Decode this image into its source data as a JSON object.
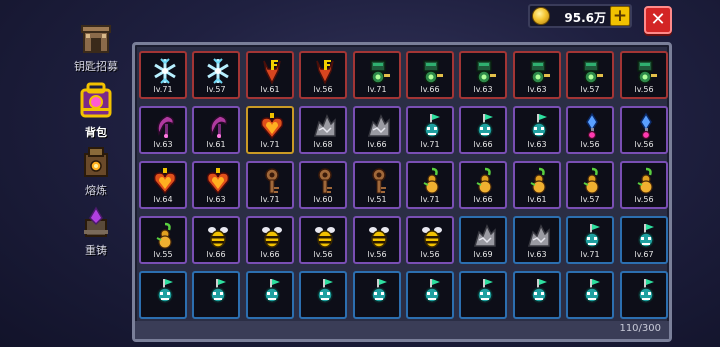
{
  "nav": [
    {
      "label": "钥匙招募",
      "icon": "gate-icon",
      "active": false
    },
    {
      "label": "背包",
      "icon": "backpack-icon",
      "active": true
    },
    {
      "label": "熔炼",
      "icon": "furnace-icon",
      "active": false
    },
    {
      "label": "重铸",
      "icon": "recast-icon",
      "active": false
    }
  ],
  "currency": {
    "value": "95.6万",
    "icon": "coin-icon"
  },
  "capacity": "110/300",
  "rarity_colors": {
    "red": "#a33535",
    "gold": "#c99a25",
    "purple": "#7a4fb4",
    "blue": "#2c6fb0"
  },
  "inventory": [
    [
      {
        "icon": "ice-key-icon",
        "level": "lv.71",
        "rarity": "red"
      },
      {
        "icon": "ice-key-icon",
        "level": "lv.57",
        "rarity": "red"
      },
      {
        "icon": "demon-key-icon",
        "level": "lv.61",
        "rarity": "red"
      },
      {
        "icon": "demon-key-icon",
        "level": "lv.56",
        "rarity": "red"
      },
      {
        "icon": "green-helmet-key-icon",
        "level": "lv.71",
        "rarity": "red"
      },
      {
        "icon": "green-helmet-key-icon",
        "level": "lv.66",
        "rarity": "red"
      },
      {
        "icon": "green-helmet-key-icon",
        "level": "lv.63",
        "rarity": "red"
      },
      {
        "icon": "green-helmet-key-icon",
        "level": "lv.63",
        "rarity": "red"
      },
      {
        "icon": "green-helmet-key-icon",
        "level": "lv.57",
        "rarity": "red"
      },
      {
        "icon": "green-helmet-key-icon",
        "level": "lv.56",
        "rarity": "red"
      }
    ],
    [
      {
        "icon": "scythe-key-icon",
        "level": "lv.63",
        "rarity": "purple"
      },
      {
        "icon": "scythe-key-icon",
        "level": "lv.61",
        "rarity": "purple"
      },
      {
        "icon": "fire-heart-key-icon",
        "level": "lv.71",
        "rarity": "gold"
      },
      {
        "icon": "stone-key-icon",
        "level": "lv.68",
        "rarity": "purple"
      },
      {
        "icon": "stone-key-icon",
        "level": "lv.66",
        "rarity": "purple"
      },
      {
        "icon": "flag-skull-key-icon",
        "level": "lv.71",
        "rarity": "purple"
      },
      {
        "icon": "flag-skull-key-icon",
        "level": "lv.66",
        "rarity": "purple"
      },
      {
        "icon": "flag-skull-key-icon",
        "level": "lv.63",
        "rarity": "purple"
      },
      {
        "icon": "crystal-key-icon",
        "level": "lv.56",
        "rarity": "purple"
      },
      {
        "icon": "crystal-key-icon",
        "level": "lv.56",
        "rarity": "purple"
      }
    ],
    [
      {
        "icon": "fire-heart-key-icon",
        "level": "lv.64",
        "rarity": "purple"
      },
      {
        "icon": "fire-heart-key-icon",
        "level": "lv.63",
        "rarity": "purple"
      },
      {
        "icon": "bronze-key-icon",
        "level": "lv.71",
        "rarity": "purple"
      },
      {
        "icon": "bronze-key-icon",
        "level": "lv.60",
        "rarity": "purple"
      },
      {
        "icon": "bronze-key-icon",
        "level": "lv.51",
        "rarity": "purple"
      },
      {
        "icon": "gourd-key-icon",
        "level": "lv.71",
        "rarity": "purple"
      },
      {
        "icon": "gourd-key-icon",
        "level": "lv.66",
        "rarity": "purple"
      },
      {
        "icon": "gourd-key-icon",
        "level": "lv.61",
        "rarity": "purple"
      },
      {
        "icon": "gourd-key-icon",
        "level": "lv.57",
        "rarity": "purple"
      },
      {
        "icon": "gourd-key-icon",
        "level": "lv.56",
        "rarity": "purple"
      }
    ],
    [
      {
        "icon": "gourd-key-icon",
        "level": "lv.55",
        "rarity": "purple"
      },
      {
        "icon": "bee-key-icon",
        "level": "lv.66",
        "rarity": "purple"
      },
      {
        "icon": "bee-key-icon",
        "level": "lv.66",
        "rarity": "purple"
      },
      {
        "icon": "bee-key-icon",
        "level": "lv.56",
        "rarity": "purple"
      },
      {
        "icon": "bee-key-icon",
        "level": "lv.56",
        "rarity": "purple"
      },
      {
        "icon": "bee-key-icon",
        "level": "lv.56",
        "rarity": "purple"
      },
      {
        "icon": "stone-key-icon",
        "level": "lv.69",
        "rarity": "blue"
      },
      {
        "icon": "stone-key-icon",
        "level": "lv.63",
        "rarity": "blue"
      },
      {
        "icon": "flag-skull-key-icon",
        "level": "lv.71",
        "rarity": "blue"
      },
      {
        "icon": "flag-skull-key-icon",
        "level": "lv.67",
        "rarity": "blue"
      }
    ],
    [
      {
        "icon": "flag-skull-key-icon",
        "level": "",
        "rarity": "blue"
      },
      {
        "icon": "flag-skull-key-icon",
        "level": "",
        "rarity": "blue"
      },
      {
        "icon": "flag-skull-key-icon",
        "level": "",
        "rarity": "blue"
      },
      {
        "icon": "flag-skull-key-icon",
        "level": "",
        "rarity": "blue"
      },
      {
        "icon": "flag-skull-key-icon",
        "level": "",
        "rarity": "blue"
      },
      {
        "icon": "flag-skull-key-icon",
        "level": "",
        "rarity": "blue"
      },
      {
        "icon": "flag-skull-key-icon",
        "level": "",
        "rarity": "blue"
      },
      {
        "icon": "flag-skull-key-icon",
        "level": "",
        "rarity": "blue"
      },
      {
        "icon": "flag-skull-key-icon",
        "level": "",
        "rarity": "blue"
      },
      {
        "icon": "flag-skull-key-icon",
        "level": "",
        "rarity": "blue"
      }
    ]
  ]
}
